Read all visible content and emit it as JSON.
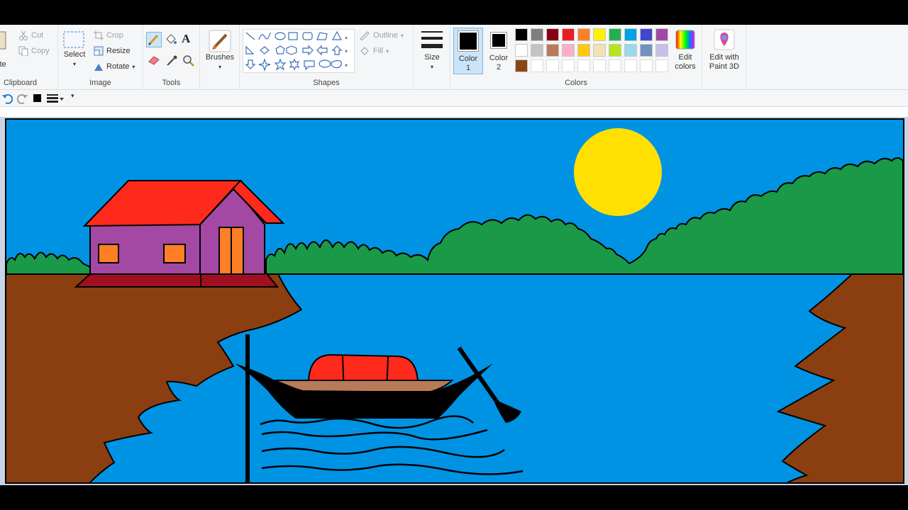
{
  "ribbon": {
    "clipboard": {
      "paste_label": "ste",
      "cut_label": "Cut",
      "copy_label": "Copy",
      "group_label": "Clipboard"
    },
    "image": {
      "select_label": "Select",
      "crop_label": "Crop",
      "resize_label": "Resize",
      "rotate_label": "Rotate",
      "group_label": "Image"
    },
    "tools": {
      "group_label": "Tools"
    },
    "brushes": {
      "label": "Brushes"
    },
    "shapes": {
      "outline_label": "Outline",
      "fill_label": "Fill",
      "group_label": "Shapes"
    },
    "size": {
      "label": "Size"
    },
    "color1": {
      "label_line1": "Color",
      "label_line2": "1",
      "value": "#000000"
    },
    "color2": {
      "label_line1": "Color",
      "label_line2": "2",
      "value": "#ffffff"
    },
    "colors": {
      "group_label": "Colors",
      "palette_row1": [
        "#000000",
        "#7f7f7f",
        "#880015",
        "#ed1c24",
        "#ff7f27",
        "#fff200",
        "#22b14c",
        "#00a2e8",
        "#3f48cc",
        "#a349a4"
      ],
      "palette_row2": [
        "#ffffff",
        "#c3c3c3",
        "#b97a57",
        "#ffaec9",
        "#ffc90e",
        "#efe4b0",
        "#b5e61d",
        "#99d9ea",
        "#7092be",
        "#c8bfe7"
      ],
      "palette_row3": [
        "#8b4513",
        "",
        "",
        "",
        "",
        "",
        "",
        "",
        "",
        ""
      ]
    },
    "edit_colors": {
      "label_line1": "Edit",
      "label_line2": "colors"
    },
    "paint3d": {
      "label_line1": "Edit with",
      "label_line2": "Paint 3D"
    }
  },
  "drawing": {
    "sky_color": "#0093e4",
    "grass_color": "#1a9948",
    "ground_color": "#8b3f10",
    "water_color": "#0093e4",
    "sun_color": "#ffe000",
    "roof_color": "#ff2a1c",
    "house_wall_color": "#a349a4",
    "window_color": "#ff7f27",
    "foundation_color": "#a01020",
    "boat_hull_color": "#000000",
    "boat_cover_color": "#ff2a1c",
    "boat_deck_color": "#b97a57"
  }
}
